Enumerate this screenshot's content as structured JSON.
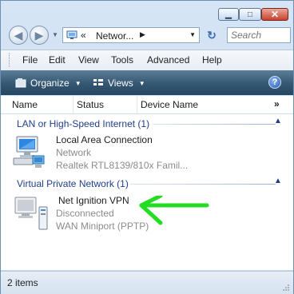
{
  "window": {
    "min_glyph": "▁",
    "max_glyph": "□",
    "close_glyph": "✕"
  },
  "address": {
    "chevrons": "«",
    "path": "Networ...",
    "separator": "▶",
    "dropdown": "▼",
    "search_placeholder": "Search"
  },
  "nav": {
    "back": "◀",
    "forward": "▶",
    "history": "▼",
    "refresh": "↻"
  },
  "menu": {
    "file": "File",
    "edit": "Edit",
    "view": "View",
    "tools": "Tools",
    "advanced": "Advanced",
    "help": "Help"
  },
  "toolbar": {
    "organize": "Organize",
    "views": "Views",
    "dropdown": "▼",
    "help": "?"
  },
  "columns": {
    "name": "Name",
    "status": "Status",
    "device": "Device Name",
    "more": "»"
  },
  "groups": [
    {
      "title": "LAN or High-Speed Internet (1)",
      "collapse": "▲",
      "items": [
        {
          "name": "Local Area Connection",
          "status": "Network",
          "device": "Realtek RTL8139/810x Famil..."
        }
      ]
    },
    {
      "title": "Virtual Private Network (1)",
      "collapse": "▲",
      "items": [
        {
          "name": "Net Ignition VPN",
          "status": "Disconnected",
          "device": "WAN Miniport (PPTP)"
        }
      ]
    }
  ],
  "statusbar": {
    "count": "2 items"
  },
  "colors": {
    "group_title": "#1e3f8a",
    "arrow": "#22dd22",
    "toolbar_dark": "#25465f"
  },
  "icons": {
    "network_adapter": "network-adapter-icon",
    "vpn": "vpn-connection-icon",
    "annotation": "green-arrow"
  }
}
